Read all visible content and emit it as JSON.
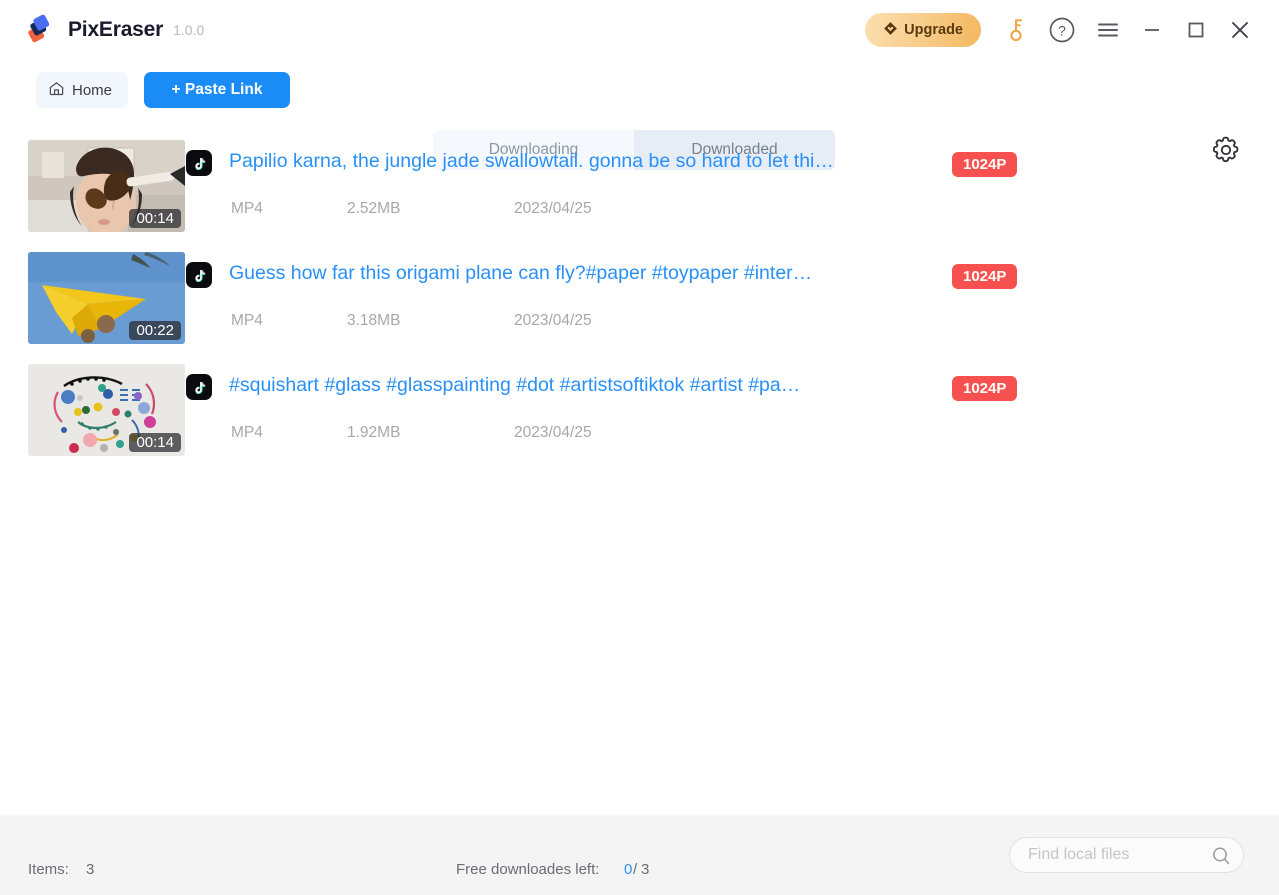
{
  "app": {
    "name": "PixEraser",
    "version": "1.0.0",
    "logo_icon": "eraser-logo-icon",
    "accent_blue": "#1b8cf5",
    "accent_red": "#f7514f",
    "accent_orange": "#f3b75f"
  },
  "titlebar": {
    "upgrade_label": "Upgrade",
    "upgrade_icon": "diamond-heart-icon",
    "key_icon": "key-icon",
    "help_icon": "question-circle-icon",
    "menu_icon": "hamburger-menu-icon",
    "minimize_icon": "minimize-icon",
    "maximize_icon": "maximize-icon",
    "close_icon": "close-icon"
  },
  "toolbar": {
    "home_label": "Home",
    "home_icon": "home-icon",
    "paste_link_label": "+ Paste Link",
    "settings_icon": "gear-icon",
    "tabs": [
      {
        "label": "Downloading",
        "active": false
      },
      {
        "label": "Downloaded",
        "active": true
      }
    ]
  },
  "list": {
    "items": [
      {
        "title": "Papilio karna, the jungle jade swallowtail. gonna be so hard to let thi…",
        "duration": "00:14",
        "format": "MP4",
        "size": "2.52MB",
        "date": "2023/04/25",
        "quality": "1024P",
        "source_icon": "tiktok-icon",
        "thumbnail": "woman-with-butterfly-thumbnail"
      },
      {
        "title": "Guess how far this origami plane can fly?#paper #toypaper #inter…",
        "duration": "00:22",
        "format": "MP4",
        "size": "3.18MB",
        "date": "2023/04/25",
        "quality": "1024P",
        "source_icon": "tiktok-icon",
        "thumbnail": "yellow-origami-plane-thumbnail"
      },
      {
        "title": "#squishart #glass #glasspainting #dot #artistsoftiktok #artist #pa…",
        "duration": "00:14",
        "format": "MP4",
        "size": "1.92MB",
        "date": "2023/04/25",
        "quality": "1024P",
        "source_icon": "tiktok-icon",
        "thumbnail": "colorful-dot-art-thumbnail"
      }
    ]
  },
  "statusbar": {
    "items_label": "Items:",
    "items_count": "3",
    "free_downloads_label": "Free downloades left:",
    "free_downloads_used": "0",
    "free_downloads_separator": "/",
    "free_downloads_total": "3",
    "search_placeholder": "Find local files",
    "search_value": "",
    "search_icon": "search-icon"
  }
}
